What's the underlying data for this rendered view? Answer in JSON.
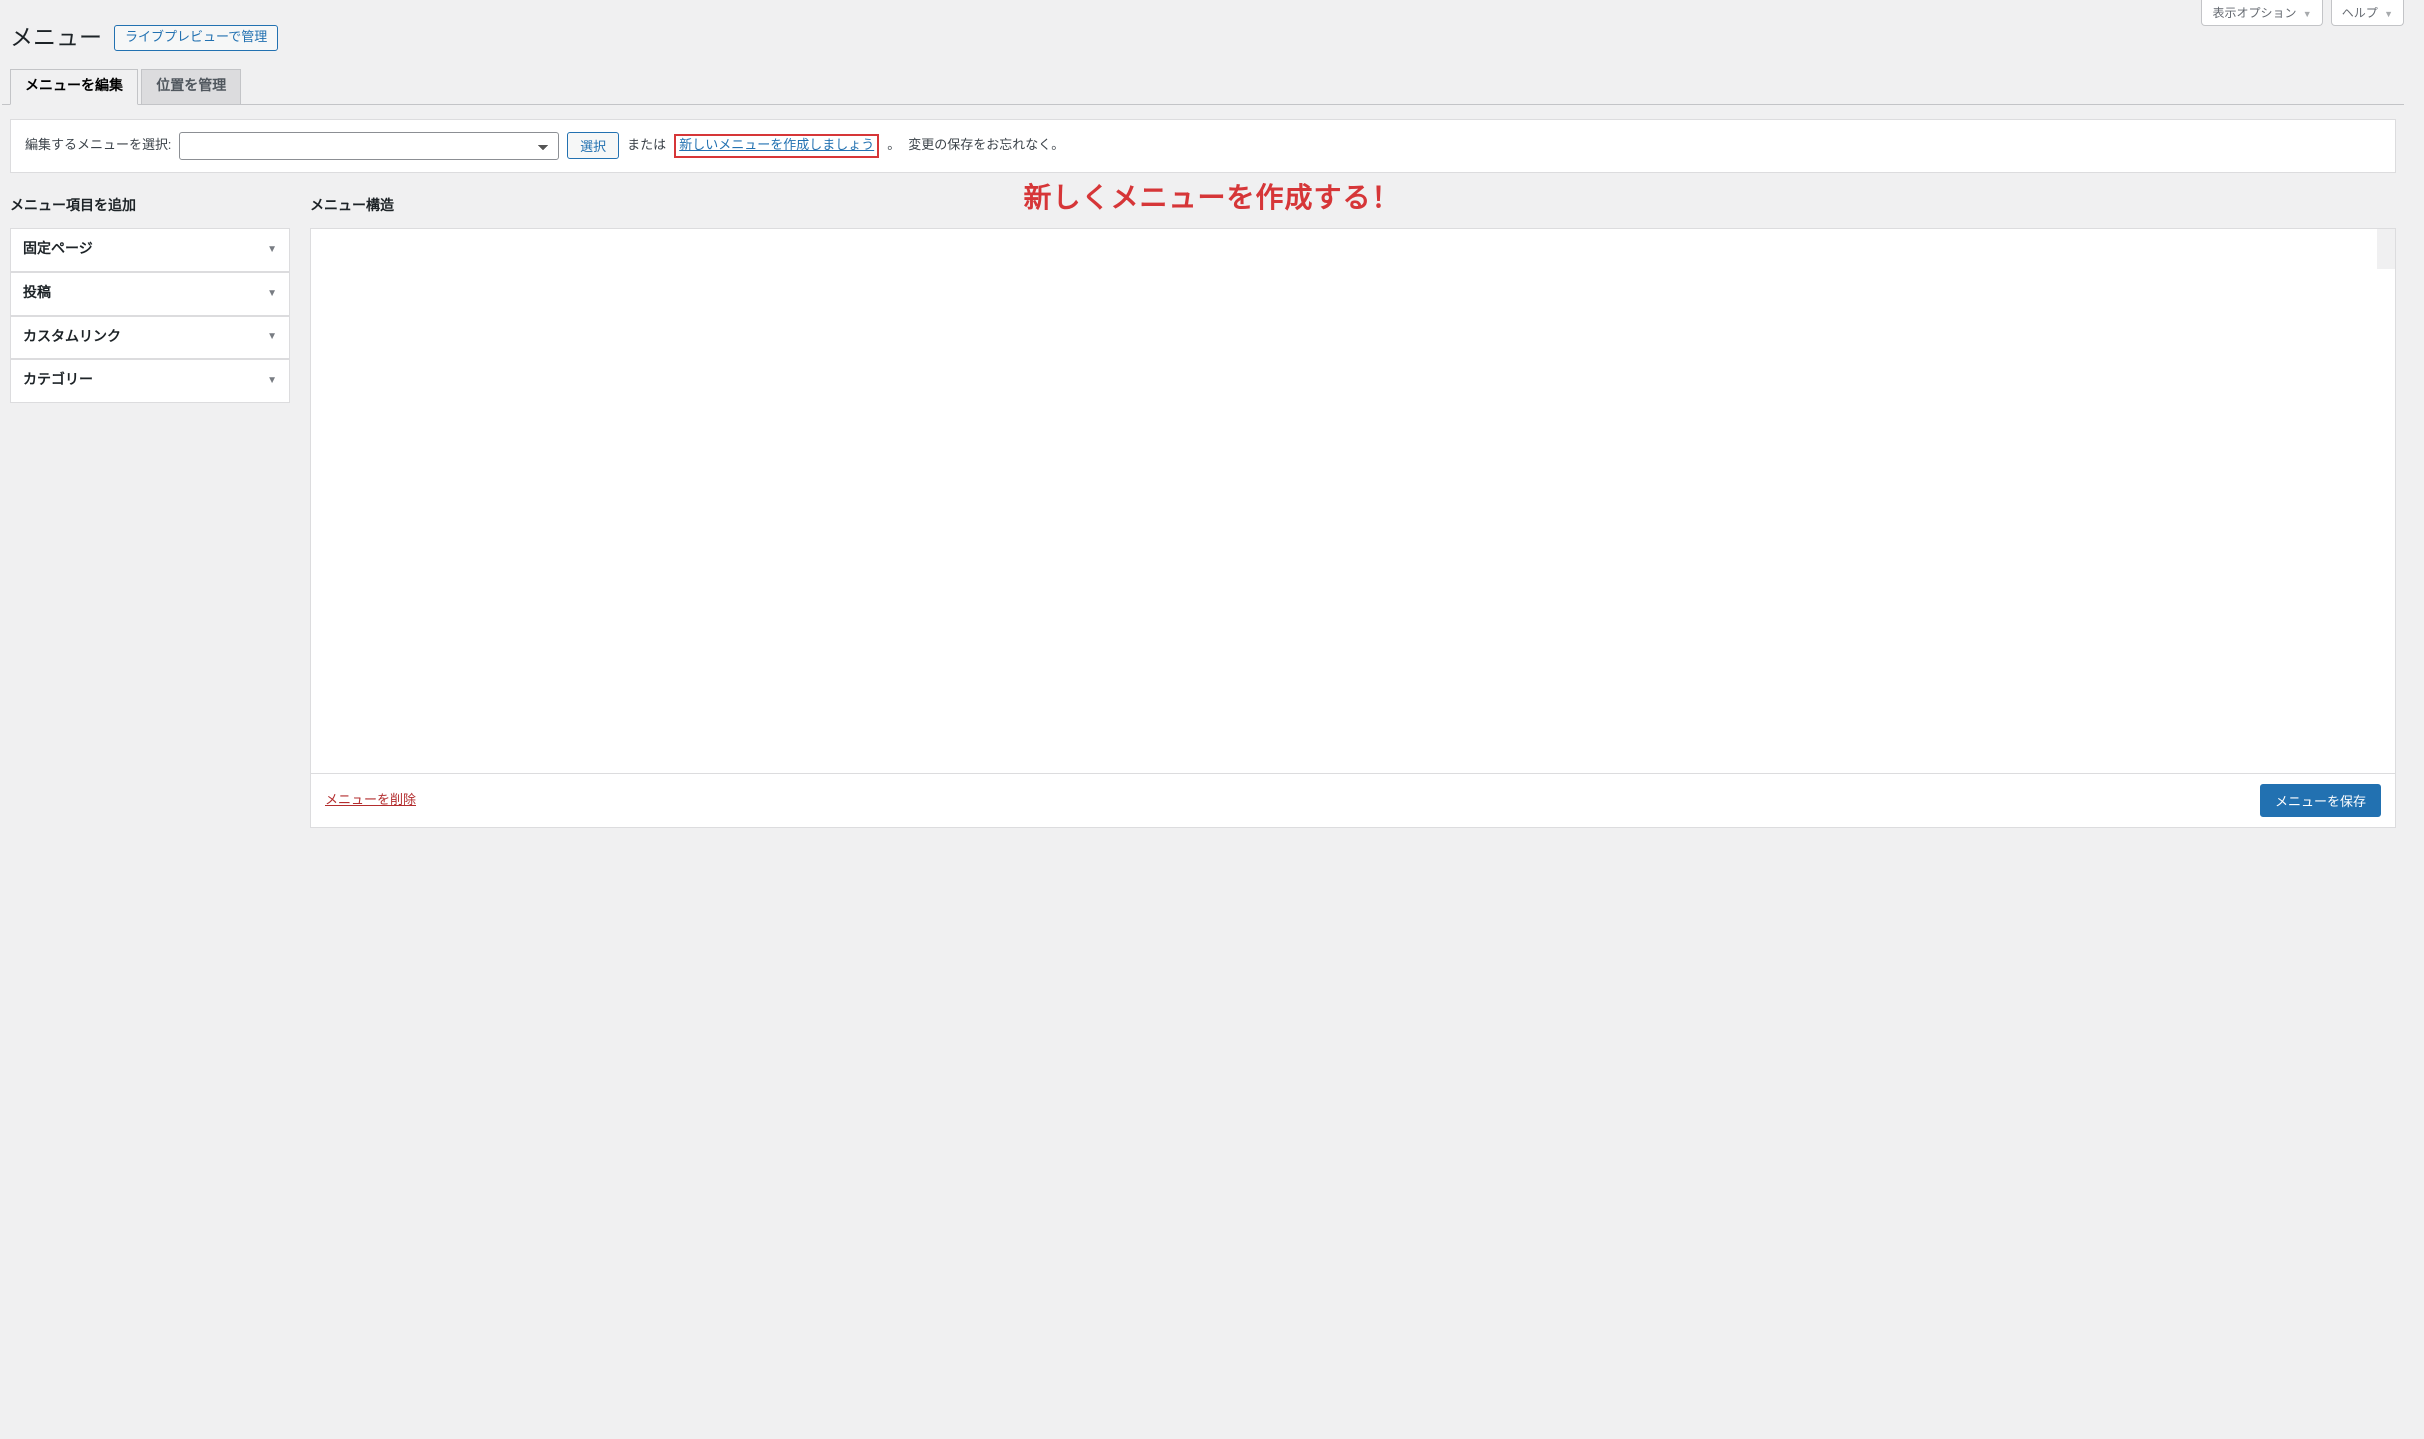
{
  "screen_meta": {
    "options_label": "表示オプション",
    "help_label": "ヘルプ"
  },
  "heading": {
    "title": "メニュー",
    "live_preview_button": "ライブプレビューで管理"
  },
  "tabs": {
    "edit": "メニューを編集",
    "locations": "位置を管理"
  },
  "manage_bar": {
    "label": "編集するメニューを選択:",
    "select_button": "選択",
    "or_text": "または",
    "create_link": "新しいメニューを作成しましょう",
    "period": "。",
    "save_hint": "変更の保存をお忘れなく。"
  },
  "annotation_text": "新しくメニューを作成する！",
  "sidebar": {
    "heading": "メニュー項目を追加",
    "items": [
      {
        "label": "固定ページ"
      },
      {
        "label": "投稿"
      },
      {
        "label": "カスタムリンク"
      },
      {
        "label": "カテゴリー"
      }
    ]
  },
  "main": {
    "heading": "メニュー構造",
    "delete_link": "メニューを削除",
    "save_button": "メニューを保存"
  }
}
